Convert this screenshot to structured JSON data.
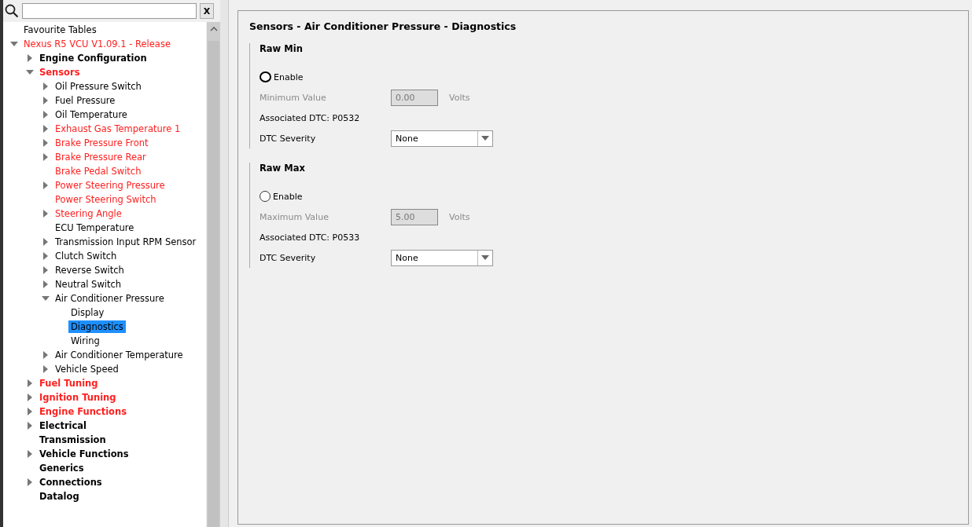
{
  "search": {
    "clear_label": "X"
  },
  "tree": [
    {
      "label": "Favourite Tables",
      "color": "#000000",
      "selected": false
    },
    {
      "label": "Nexus R5 VCU V1.09.1 - Release",
      "color": "#ff2020",
      "selected": false,
      "expanded": true,
      "children": [
        {
          "label": "Engine Configuration",
          "color": "#000000",
          "selected": false,
          "expanded": false
        },
        {
          "label": "Sensors",
          "color": "#ff2020",
          "selected": false,
          "expanded": true,
          "children": [
            {
              "label": "Oil Pressure Switch",
              "color": "#000000",
              "selected": false,
              "expanded": false
            },
            {
              "label": "Fuel Pressure",
              "color": "#000000",
              "selected": false,
              "expanded": false
            },
            {
              "label": "Oil Temperature",
              "color": "#000000",
              "selected": false,
              "expanded": false
            },
            {
              "label": "Exhaust Gas Temperature 1",
              "color": "#ff2020",
              "selected": false,
              "expanded": false
            },
            {
              "label": "Brake Pressure Front",
              "color": "#ff2020",
              "selected": false,
              "expanded": false
            },
            {
              "label": "Brake Pressure Rear",
              "color": "#ff2020",
              "selected": false,
              "expanded": false
            },
            {
              "label": "Brake Pedal Switch",
              "color": "#ff2020",
              "selected": false
            },
            {
              "label": "Power Steering Pressure",
              "color": "#ff2020",
              "selected": false,
              "expanded": false
            },
            {
              "label": "Power Steering Switch",
              "color": "#ff2020",
              "selected": false
            },
            {
              "label": "Steering Angle",
              "color": "#ff2020",
              "selected": false,
              "expanded": false
            },
            {
              "label": "ECU Temperature",
              "color": "#000000",
              "selected": false
            },
            {
              "label": "Transmission Input RPM Sensor",
              "color": "#000000",
              "selected": false,
              "expanded": false
            },
            {
              "label": "Clutch Switch",
              "color": "#000000",
              "selected": false,
              "expanded": false
            },
            {
              "label": "Reverse Switch",
              "color": "#000000",
              "selected": false,
              "expanded": false
            },
            {
              "label": "Neutral Switch",
              "color": "#000000",
              "selected": false,
              "expanded": false
            },
            {
              "label": "Air Conditioner Pressure",
              "color": "#000000",
              "selected": false,
              "expanded": true,
              "children": [
                {
                  "label": "Display",
                  "color": "#000000",
                  "selected": false
                },
                {
                  "label": "Diagnostics",
                  "selected": true
                },
                {
                  "label": "Wiring",
                  "color": "#000000",
                  "selected": false
                }
              ]
            },
            {
              "label": "Air Conditioner Temperature",
              "color": "#000000",
              "selected": false,
              "expanded": false
            },
            {
              "label": "Vehicle Speed",
              "color": "#000000",
              "selected": false,
              "expanded": false
            }
          ]
        },
        {
          "label": "Fuel Tuning",
          "color": "#ff2020",
          "selected": false,
          "expanded": false
        },
        {
          "label": "Ignition Tuning",
          "color": "#ff2020",
          "selected": false,
          "expanded": false
        },
        {
          "label": "Engine Functions",
          "color": "#ff2020",
          "selected": false,
          "expanded": false
        },
        {
          "label": "Electrical",
          "color": "#000000",
          "selected": false,
          "expanded": false
        },
        {
          "label": "Transmission",
          "color": "#000000",
          "selected": false
        },
        {
          "label": "Vehicle Functions",
          "color": "#000000",
          "selected": false,
          "expanded": false
        },
        {
          "label": "Generics",
          "color": "#000000",
          "selected": false
        },
        {
          "label": "Connections",
          "color": "#000000",
          "selected": false,
          "expanded": false
        },
        {
          "label": "Datalog",
          "color": "#000000",
          "selected": false
        }
      ]
    }
  ],
  "panel": {
    "title": "Sensors - Air Conditioner Pressure - Diagnostics",
    "groups": [
      {
        "title": "Raw Min",
        "enable": {
          "label": "Enable",
          "checked": false,
          "focused": true
        },
        "value_label": "Minimum Value",
        "value": "0.00",
        "unit": "Volts",
        "disabled": true,
        "dtc": "Associated DTC: P0532",
        "severity_label": "DTC Severity",
        "severity": "None"
      },
      {
        "title": "Raw Max",
        "enable": {
          "label": "Enable",
          "checked": false,
          "focused": false
        },
        "value_label": "Maximum Value",
        "value": "5.00",
        "unit": "Volts",
        "disabled": true,
        "dtc": "Associated DTC: P0533",
        "severity_label": "DTC Severity",
        "severity": "None"
      }
    ]
  }
}
